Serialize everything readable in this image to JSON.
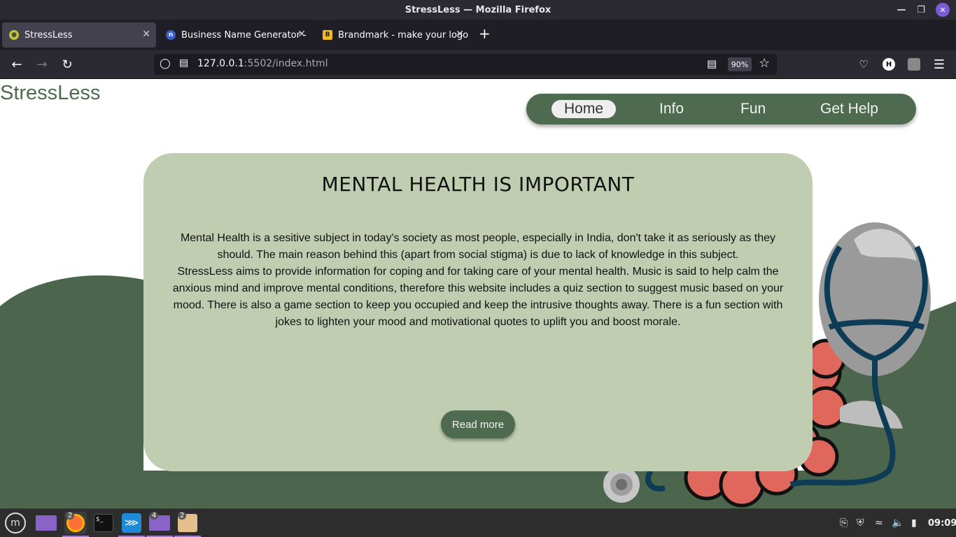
{
  "window": {
    "title": "StressLess — Mozilla Firefox"
  },
  "tabs": [
    {
      "label": "StressLess"
    },
    {
      "label": "Business Name Generator -"
    },
    {
      "label": "Brandmark - make your logo"
    }
  ],
  "urlbar": {
    "host": "127.0.0.1",
    "path": ":5502/index.html",
    "zoom": "90%"
  },
  "site": {
    "logo": "StressLess",
    "nav": [
      "Home",
      "Info",
      "Fun",
      "Get Help"
    ],
    "card": {
      "title": "MENTAL HEALTH IS IMPORTANT",
      "paragraph1": "Mental Health is a sesitive subject in today's society as most people, especially in India, don't take it as seriously as they should. The main reason behind this (apart from social stigma) is due to lack of knowledge in this subject.",
      "paragraph2": "StressLess aims to provide information for coping and for taking care of your mental health. Music is said to help calm the anxious mind and improve mental conditions, therefore this website includes a quiz section to suggest music based on your mood. There is also a game section to keep you occupied and keep the intrusive thoughts away. There is a fun section with jokes to lighten your mood and motivational quotes to uplift you and boost morale.",
      "button": "Read more"
    }
  },
  "taskbar": {
    "badges": {
      "firefox": "2",
      "files2": "4",
      "archive": "2"
    },
    "clock": "09:09"
  },
  "colors": {
    "brand_green": "#4f6b4f",
    "card_bg": "#c0cdb1",
    "hill": "#4c654d"
  }
}
